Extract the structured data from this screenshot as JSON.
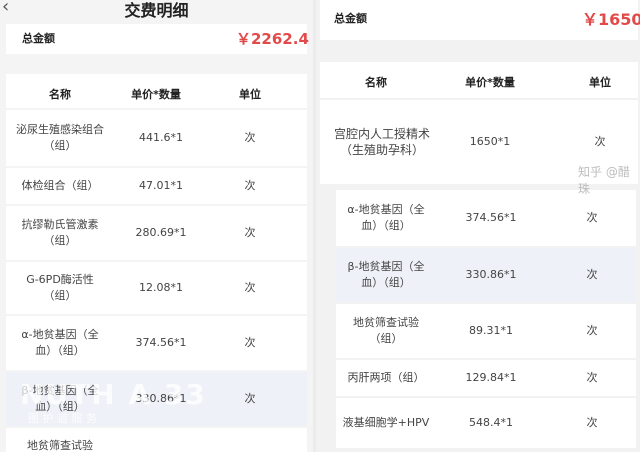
{
  "left": {
    "back_icon": "chevron-left-icon",
    "title": "交费明细",
    "total_label": "总金额",
    "total_amount": "￥2262.4",
    "headers": {
      "name": "名称",
      "price": "单价*数量",
      "unit": "单位"
    },
    "rows": [
      {
        "name": "泌尿生殖感染组合（组）",
        "price": "441.6*1",
        "unit": "次"
      },
      {
        "name": "体检组合（组）",
        "price": "47.01*1",
        "unit": "次"
      },
      {
        "name": "抗缪勒氏管激素（组）",
        "price": "280.69*1",
        "unit": "次"
      },
      {
        "name": "G-6PD酶活性（组）",
        "price": "12.08*1",
        "unit": "次"
      },
      {
        "name": "α-地贫基因（全血）（组）",
        "price": "374.56*1",
        "unit": "次"
      },
      {
        "name": "β-地贫基因（全血）（组）",
        "price": "330.86*1",
        "unit": "次"
      },
      {
        "name": "地贫筛查试验",
        "price": "",
        "unit": ""
      }
    ],
    "overlay": {
      "main": "NUTH A 33",
      "sub": "图 护 道 服 务"
    }
  },
  "right": {
    "total_label": "总金额",
    "total_amount": "￥1650",
    "headers": {
      "name": "名称",
      "price": "单价*数量",
      "unit": "单位"
    },
    "rows": [
      {
        "name": "宫腔内人工授精术（生殖助孕科）",
        "price": "1650*1",
        "unit": "次"
      },
      {
        "name": "α-地贫基因（全血）（组）",
        "price": "374.56*1",
        "unit": "次"
      },
      {
        "name": "β-地贫基因（全血）（组）",
        "price": "330.86*1",
        "unit": "次"
      },
      {
        "name": "地贫筛查试验（组）",
        "price": "89.31*1",
        "unit": "次"
      },
      {
        "name": "丙肝两项（组）",
        "price": "129.84*1",
        "unit": "次"
      },
      {
        "name": "液基细胞学+HPV",
        "price": "548.4*1",
        "unit": "次"
      }
    ],
    "watermark": "知乎 @醋珠"
  }
}
